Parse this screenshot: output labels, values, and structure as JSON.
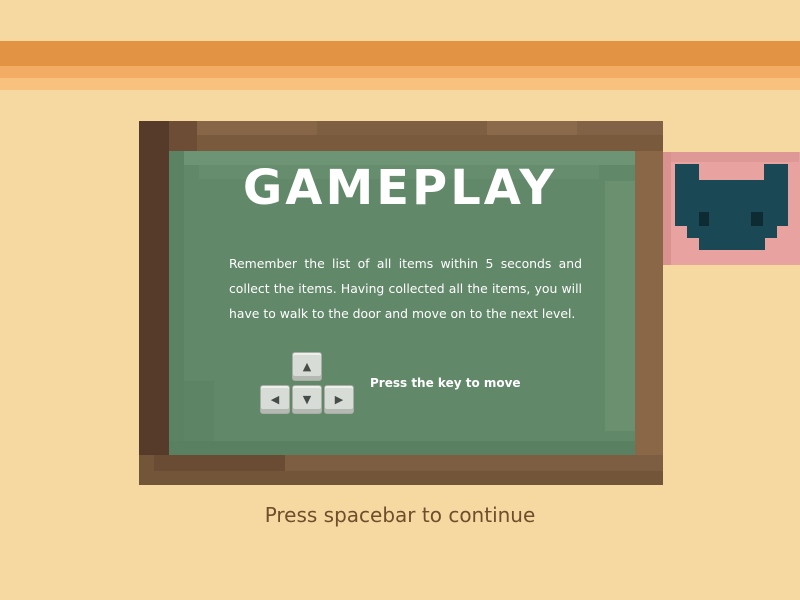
{
  "title": "GAMEPLAY",
  "description": "Remember the list of all items within 5 seconds and collect the items. Having collected all the items, you will have to walk to the door and move on to the next level.",
  "controls": {
    "hint": "Press the key to move",
    "keys": {
      "up": "▲",
      "left": "◀",
      "down": "▼",
      "right": "▶"
    }
  },
  "prompt": "Press spacebar to continue",
  "colors": {
    "background": "#f5d9a0",
    "stripe_dark": "#e29444",
    "stripe_mid": "#f3ac64",
    "stripe_light": "#f8c17e",
    "board_frame": "#7a5a3d",
    "board_surface": "#62886a",
    "character_body": "#1b4855",
    "character_outline": "#e8a3a0",
    "prompt_text": "#6e4e2c"
  },
  "icons": {
    "character": "teal-cat-character-icon",
    "arrow_keys": "arrow-keys-icon"
  }
}
